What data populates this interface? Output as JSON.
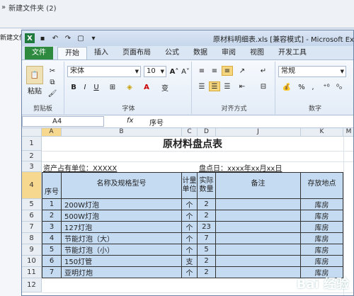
{
  "explorer": {
    "path_sep": "»",
    "path_folder": "新建文件夹 (2)",
    "side_label": "新建文件"
  },
  "window": {
    "title": "原材料明细表.xls [兼容模式] - Microsoft Excel"
  },
  "ribbon_tabs": [
    "文件",
    "开始",
    "插入",
    "页面布局",
    "公式",
    "数据",
    "审阅",
    "视图",
    "开发工具"
  ],
  "ribbon": {
    "paste_label": "粘贴",
    "font_name": "宋体",
    "font_size": "10",
    "number_format": "常规",
    "group_clipboard": "剪贴板",
    "group_font": "字体",
    "group_align": "对齐方式",
    "group_number": "数字",
    "percent": "%",
    "comma": ","
  },
  "formula_bar": {
    "name_box": "A4",
    "fx": "fx",
    "value": "序号"
  },
  "columns": [
    "A",
    "B",
    "C",
    "D",
    "J",
    "K",
    "M"
  ],
  "rows": [
    "1",
    "2",
    "3",
    "4",
    "5",
    "6",
    "7",
    "8",
    "9",
    "10",
    "11",
    "12"
  ],
  "sheet": {
    "title": "原材料盘点表",
    "owner": "资产占有单位：XXXXX",
    "date": "盘点日：xxxx年xx月xx日",
    "headers": {
      "no": "序号",
      "name": "名称及规格型号",
      "unit": "计量单位",
      "qty": "实际数量",
      "note": "备注",
      "loc": "存放地点"
    },
    "data": [
      {
        "no": "1",
        "name": "200W灯泡",
        "unit": "个",
        "qty": "2",
        "loc": "库房"
      },
      {
        "no": "2",
        "name": "500W灯泡",
        "unit": "个",
        "qty": "2",
        "loc": "库房"
      },
      {
        "no": "3",
        "name": "127灯泡",
        "unit": "个",
        "qty": "23",
        "loc": "库房"
      },
      {
        "no": "4",
        "name": "节能灯泡（大）",
        "unit": "个",
        "qty": "7",
        "loc": "库房"
      },
      {
        "no": "5",
        "name": "节能灯泡（小）",
        "unit": "个",
        "qty": "5",
        "loc": "库房"
      },
      {
        "no": "6",
        "name": "150灯管",
        "unit": "支",
        "qty": "2",
        "loc": "库房"
      },
      {
        "no": "7",
        "name": "亚明灯炮",
        "unit": "个",
        "qty": "2",
        "loc": "库房"
      }
    ]
  },
  "watermark": "Bai 经验"
}
